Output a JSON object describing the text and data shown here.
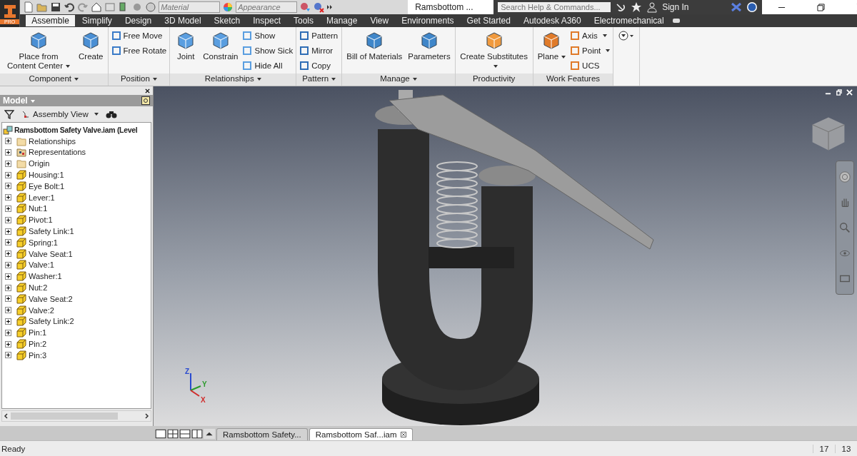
{
  "app_button": {
    "label": "PRO"
  },
  "quick_access": {
    "material": {
      "placeholder": "Material"
    },
    "appearance": {
      "placeholder": "Appearance"
    }
  },
  "window": {
    "title": "Ramsbottom ..."
  },
  "search": {
    "placeholder": "Search Help & Commands..."
  },
  "sign_in": "Sign In",
  "tabs": [
    {
      "label": "Assemble",
      "selected": true
    },
    {
      "label": "Simplify",
      "selected": false
    },
    {
      "label": "Design",
      "selected": false
    },
    {
      "label": "3D Model",
      "selected": false
    },
    {
      "label": "Sketch",
      "selected": false
    },
    {
      "label": "Inspect",
      "selected": false
    },
    {
      "label": "Tools",
      "selected": false
    },
    {
      "label": "Manage",
      "selected": false
    },
    {
      "label": "View",
      "selected": false
    },
    {
      "label": "Environments",
      "selected": false
    },
    {
      "label": "Get Started",
      "selected": false
    },
    {
      "label": "Autodesk A360",
      "selected": false
    },
    {
      "label": "Electromechanical",
      "selected": false
    }
  ],
  "ribbon_panels": [
    {
      "title": "Component",
      "menu": true,
      "tools": [
        {
          "label": "Place from Content Center",
          "kind": "large",
          "dropdown": true
        },
        {
          "label": "Create",
          "kind": "large",
          "dropdown": false
        }
      ]
    },
    {
      "title": "Position",
      "menu": true,
      "tools": [
        {
          "label": "Free Move",
          "kind": "small",
          "dropdown": false
        },
        {
          "label": "Free Rotate",
          "kind": "small",
          "dropdown": false
        }
      ]
    },
    {
      "title": "Relationships",
      "menu": true,
      "tools": [
        {
          "label": "Joint",
          "kind": "large",
          "dropdown": false
        },
        {
          "label": "Constrain",
          "kind": "large",
          "dropdown": false
        },
        {
          "label": "Show",
          "kind": "small",
          "dropdown": false
        },
        {
          "label": "Show Sick",
          "kind": "small",
          "dropdown": false
        },
        {
          "label": "Hide All",
          "kind": "small",
          "dropdown": false
        }
      ]
    },
    {
      "title": "Pattern",
      "menu": true,
      "tools": [
        {
          "label": "Pattern",
          "kind": "small",
          "dropdown": false
        },
        {
          "label": "Mirror",
          "kind": "small",
          "dropdown": false
        },
        {
          "label": "Copy",
          "kind": "small",
          "dropdown": false
        }
      ]
    },
    {
      "title": "Manage",
      "menu": true,
      "tools": [
        {
          "label": "Bill of Materials",
          "kind": "large",
          "dropdown": false
        },
        {
          "label": "Parameters",
          "kind": "large",
          "dropdown": false
        }
      ]
    },
    {
      "title": "Productivity",
      "menu": false,
      "tools": [
        {
          "label": "Create Substitutes",
          "kind": "large",
          "dropdown": true
        }
      ]
    },
    {
      "title": "Work Features",
      "menu": false,
      "tools": [
        {
          "label": "Plane",
          "kind": "large",
          "dropdown": true
        },
        {
          "label": "Axis",
          "kind": "small",
          "dropdown": true
        },
        {
          "label": "Point",
          "kind": "small",
          "dropdown": true
        },
        {
          "label": "UCS",
          "kind": "small",
          "dropdown": false
        }
      ]
    }
  ],
  "browser": {
    "title": "Model",
    "view": "Assembly View",
    "root": {
      "label": "Ramsbottom Safety Valve.iam (Level",
      "children": [
        {
          "label": "Relationships",
          "kind": "folder",
          "expanded": false
        },
        {
          "label": "Representations",
          "kind": "representations",
          "expanded": false
        },
        {
          "label": "Origin",
          "kind": "folder",
          "expanded": false
        },
        {
          "label": "Housing:1",
          "kind": "part",
          "expanded": false
        },
        {
          "label": "Eye Bolt:1",
          "kind": "part",
          "expanded": false
        },
        {
          "label": "Lever:1",
          "kind": "part",
          "expanded": false
        },
        {
          "label": "Nut:1",
          "kind": "part",
          "expanded": false
        },
        {
          "label": "Pivot:1",
          "kind": "part",
          "expanded": false
        },
        {
          "label": "Safety Link:1",
          "kind": "part",
          "expanded": false
        },
        {
          "label": "Spring:1",
          "kind": "part",
          "expanded": false
        },
        {
          "label": "Valve Seat:1",
          "kind": "part",
          "expanded": false
        },
        {
          "label": "Valve:1",
          "kind": "part",
          "expanded": false
        },
        {
          "label": "Washer:1",
          "kind": "part",
          "expanded": false
        },
        {
          "label": "Nut:2",
          "kind": "part",
          "expanded": false
        },
        {
          "label": "Valve Seat:2",
          "kind": "part",
          "expanded": false
        },
        {
          "label": "Valve:2",
          "kind": "part",
          "expanded": false
        },
        {
          "label": "Safety Link:2",
          "kind": "part",
          "expanded": false
        },
        {
          "label": "Pin:1",
          "kind": "part",
          "expanded": false
        },
        {
          "label": "Pin:2",
          "kind": "part",
          "expanded": false
        },
        {
          "label": "Pin:3",
          "kind": "part",
          "expanded": false
        }
      ]
    }
  },
  "triad": {
    "labels": [
      "Z",
      "Y",
      "X"
    ]
  },
  "document_tabs": [
    {
      "label": "Ramsbottom Safety...",
      "selected": false
    },
    {
      "label": "Ramsbottom Saf...iam",
      "selected": true
    }
  ],
  "status_bar": {
    "text": "Ready",
    "values": [
      "17",
      "13"
    ]
  }
}
